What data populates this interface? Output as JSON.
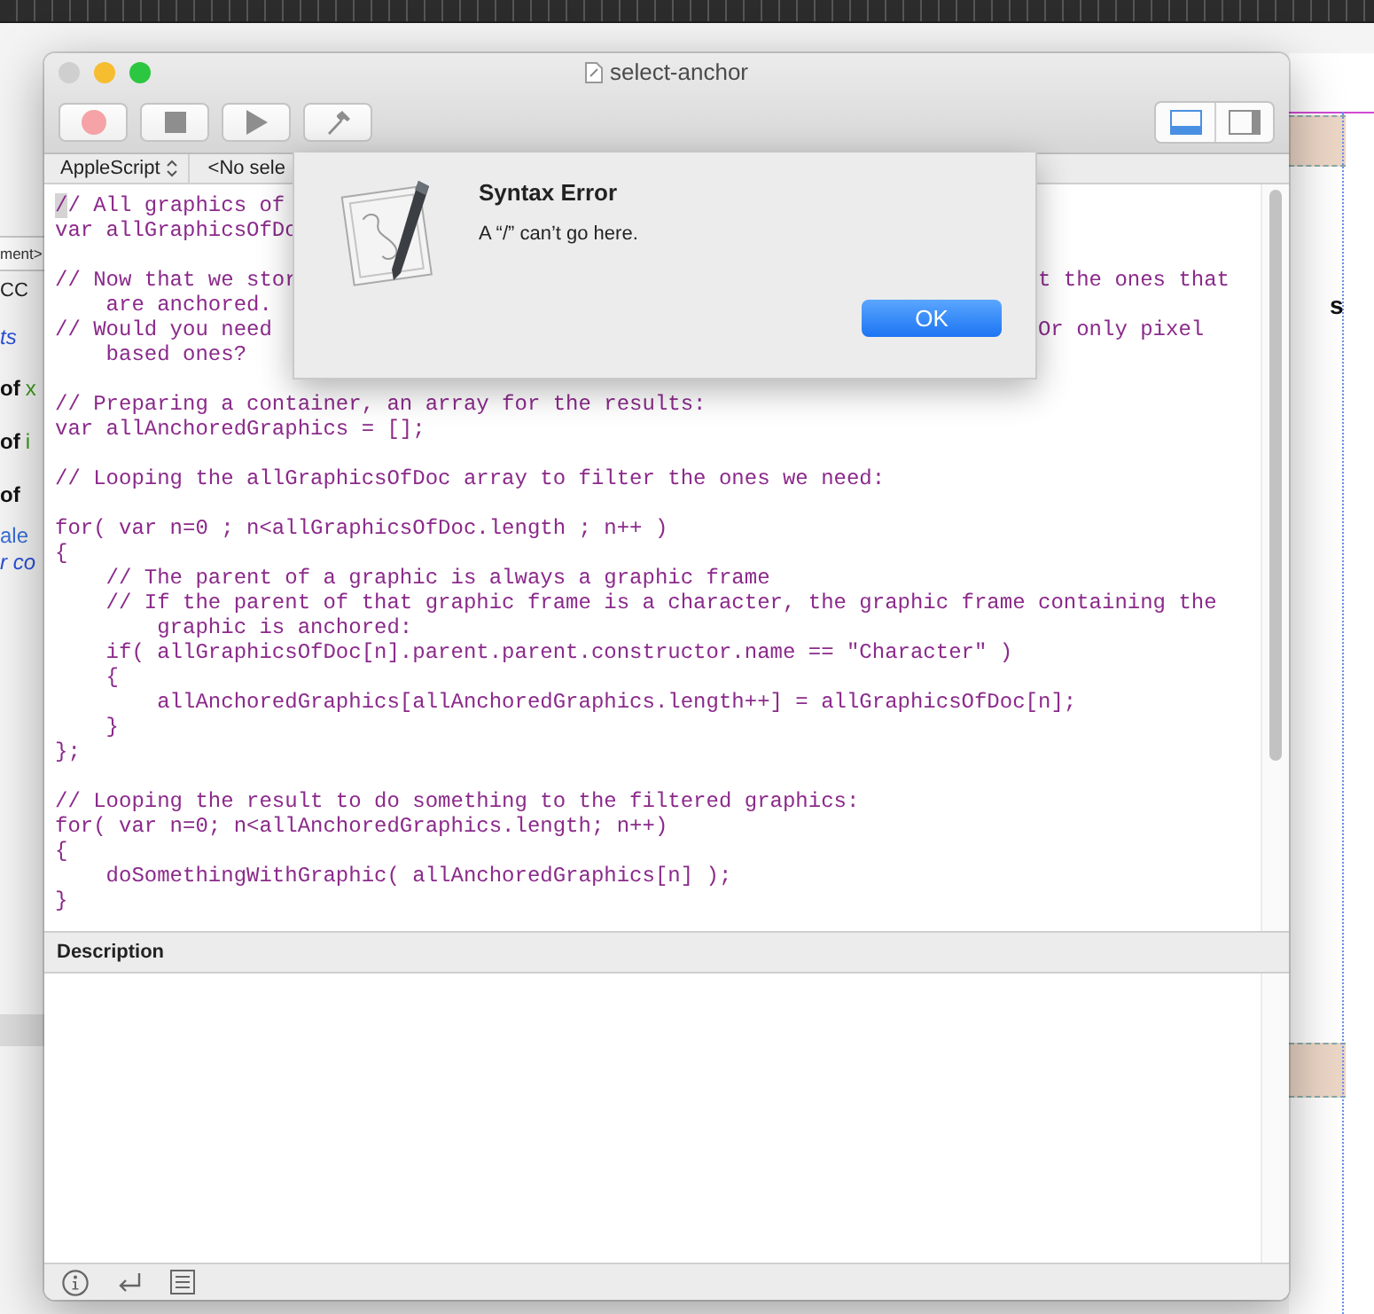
{
  "background": {
    "left_rows": [
      {
        "segments": [
          {
            "text": "ment>",
            "kind": "tag"
          }
        ]
      },
      {
        "segments": [
          {
            "text": "CC",
            "kind": "plain"
          }
        ]
      },
      {
        "segments": [
          {
            "text": "ts",
            "kind": "link"
          }
        ]
      },
      {
        "segments": [
          {
            "text": "of",
            "kind": "bold"
          },
          {
            "text": "x",
            "kind": "var"
          }
        ]
      },
      {
        "segments": [
          {
            "text": "of",
            "kind": "bold"
          },
          {
            "text": "i",
            "kind": "var"
          }
        ]
      },
      {
        "segments": [
          {
            "text": "of",
            "kind": "bold"
          }
        ]
      },
      {
        "segments": [
          {
            "text": "ale",
            "kind": "blue"
          }
        ]
      },
      {
        "segments": [
          {
            "text": "r co",
            "kind": "link"
          }
        ]
      }
    ],
    "right_text": "s"
  },
  "window": {
    "title": "select-anchor",
    "toolbar": [
      {
        "kind": "record"
      },
      {
        "kind": "stop"
      },
      {
        "kind": "run"
      },
      {
        "kind": "compile"
      }
    ],
    "view_buttons": [
      {
        "kind": "bottom-pane",
        "selected": true
      },
      {
        "kind": "side-pane",
        "selected": false
      }
    ],
    "language": "AppleScript",
    "navigation": "<No sele",
    "code": [
      {
        "lines": [
          {
            "text": "// All graphics of"
          },
          {
            "text": "var allGraphicsOfDo"
          }
        ]
      },
      {
        "lines": [
          {
            "text": "// Now that we stor",
            "tail": "t the ones that"
          },
          {
            "text": "    are anchored."
          },
          {
            "text": "// Would you need",
            "tail": "Or only pixel"
          },
          {
            "text": "    based ones?"
          }
        ]
      },
      {
        "lines": [
          {
            "text": "// Preparing a container, an array for the results:"
          },
          {
            "text": "var allAnchoredGraphics = [];"
          }
        ]
      },
      {
        "lines": [
          {
            "text": "// Looping the allGraphicsOfDoc array to filter the ones we need:"
          }
        ]
      },
      {
        "lines": [
          {
            "text": "for( var n=0 ; n<allGraphicsOfDoc.length ; n++ )"
          },
          {
            "text": "{"
          },
          {
            "text": "    // The parent of a graphic is always a graphic frame"
          },
          {
            "text": "    // If the parent of that graphic frame is a character, the graphic frame containing the"
          },
          {
            "text": "        graphic is anchored:"
          },
          {
            "text": "    if( allGraphicsOfDoc[n].parent.parent.constructor.name == \"Character\" )"
          },
          {
            "text": "    {"
          },
          {
            "text": "        allAnchoredGraphics[allAnchoredGraphics.length++] = allGraphicsOfDoc[n];"
          },
          {
            "text": "    }"
          },
          {
            "text": "};"
          }
        ]
      },
      {
        "lines": [
          {
            "text": "// Looping the result to do something to the filtered graphics:"
          },
          {
            "text": "for( var n=0; n<allAnchoredGraphics.length; n++)"
          },
          {
            "text": "{"
          },
          {
            "text": "    doSomethingWithGraphic( allAnchoredGraphics[n] );"
          },
          {
            "text": "}"
          }
        ]
      }
    ],
    "description": {
      "title": "Description"
    },
    "bottom_bar": [
      {
        "kind": "info"
      },
      {
        "kind": "return"
      },
      {
        "kind": "list"
      }
    ]
  },
  "dialog": {
    "title": "Syntax Error",
    "message": "A “/” can’t go here.",
    "button": "OK"
  }
}
